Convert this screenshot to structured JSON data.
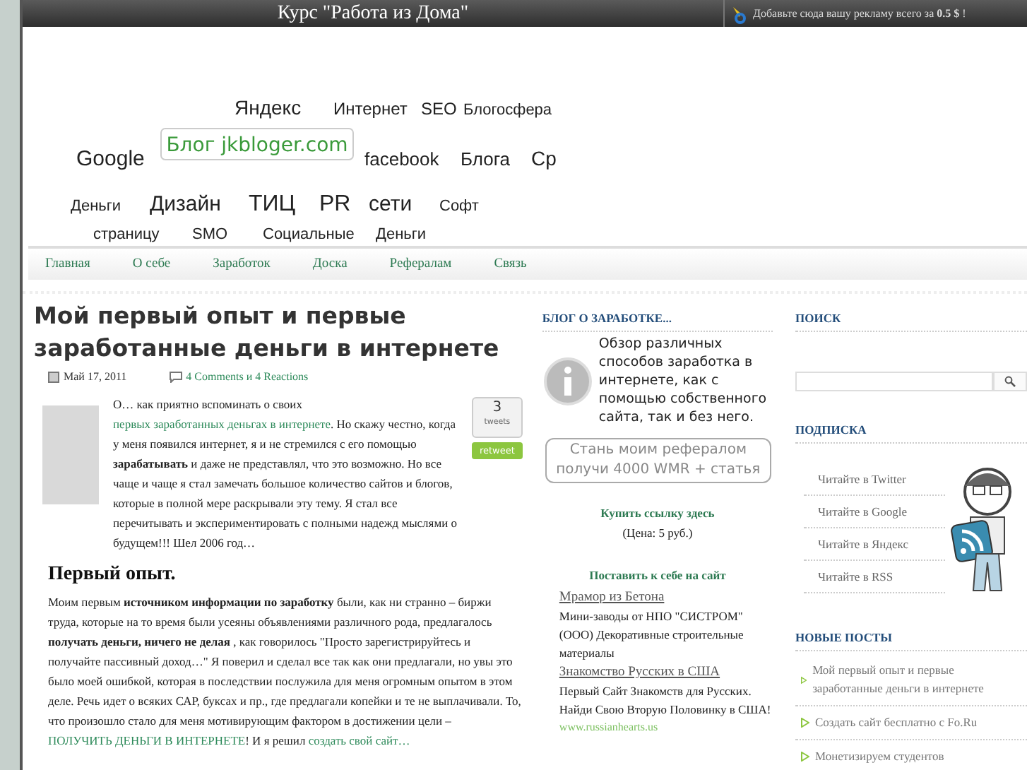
{
  "top_bar": {
    "title": "Курс \"Работа из Дома\"",
    "ad_text": "Добавьте сюда вашу рекламу всего за **0.5 $** !"
  },
  "header": {
    "logo_label": "Блог jkbloger.com",
    "cloud_words": [
      "Яндекс",
      "Интернет",
      "SEO",
      "Блогосфера",
      "Google",
      "facebook",
      "Блога",
      "Ср",
      "Деньги",
      "Дизайн",
      "ТИЦ",
      "PR",
      "сети",
      "Софт",
      "страницу",
      "SMO",
      "Социальные",
      "Деньги"
    ]
  },
  "nav": [
    "Главная",
    "О себе",
    "Заработок",
    "Доска",
    "Рефералам",
    "Связь"
  ],
  "post": {
    "title": "Мой первый опыт и первые заработанные деньги в интернете",
    "date": "Май 17, 2011",
    "comments": "4 Comments и 4 Reactions",
    "tweet_count": "3",
    "tweet_unit": "tweets",
    "retweet_label": "retweet",
    "intro": [
      {
        "kind": "text",
        "text": "О… как приятно вспоминать о своих "
      },
      {
        "kind": "link",
        "text": "первых заработанных деньгах в интернете"
      },
      {
        "kind": "text",
        "text": ". Но скажу честно, когда у меня появился интернет, я и не стремился  с его помощью **зарабатывать** и даже не представлял, что это возможно. Но все чаще и чаще я стал замечать большое количество сайтов и блогов, которые в полной мере раскрывали эту тему. Я стал все перечитывать и экспериментировать с полными надежд мыслями о будущем!!! Шел 2006 год…"
      }
    ],
    "heading": "Первый опыт.",
    "body": [
      {
        "kind": "text",
        "text": "Моим первым **источником информации по заработку**  были, как ни странно – биржи труда, которые на то время были усеяны объявлениями различного рода, предлагалось **получать деньги, ничего не делая** , как говорилось \"Просто зарегистрируйтесь и получайте пассивный доход…\" Я поверил и сделал все так как они предлагали, но увы это было моей ошибкой, которая в последствии послужила для меня огромным опытом в этом деле. Речь идет о всяких САР, буксах и пр., где предлагали копейки и те не выплачивали.  То, что произошло стало для меня мотивирующим фактором в достижении цели – "
      },
      {
        "kind": "link",
        "text": "ПОЛУЧИТЬ ДЕНЬГИ В ИНТЕРНЕТЕ"
      },
      {
        "kind": "text",
        "text": "! И я решил "
      },
      {
        "kind": "link",
        "text": "создать свой сайт…"
      }
    ]
  },
  "middle": {
    "title": "БЛОГ О ЗАРАБОТКЕ...",
    "info_text": "Обзор различных способов заработка в интернете, как с помощью собственного сайта, так и без него.",
    "referral_button": "Стань моим рефералом получи 4000 WMR + статья",
    "buy_link": "Купить ссылку здесь",
    "price": "(Цена: 5 руб.)",
    "install_link": "Поставить к себе на сайт",
    "ads": [
      {
        "title": "Мрамор из Бетона",
        "text": "Мини-заводы от НПО \"СИСТРОМ\" (ООО) Декоративные строительные материалы"
      },
      {
        "title": "Знакомство Русских в США",
        "text": "Первый Сайт Знакомств для Русских. Найди Свою Вторую Половинку в США!",
        "url": "www.russianhearts.us"
      }
    ]
  },
  "right": {
    "search_title": "ПОИСК",
    "subscribe_title": "ПОДПИСКА",
    "subscribe_links": [
      "Читайте в Twitter",
      "Читайте в Google",
      "Читайте в Яндекс",
      "Читайте в RSS"
    ],
    "posts_title": "НОВЫЕ ПОСТЫ",
    "posts": [
      "Мой первый опыт и первые заработанные деньги в интернете",
      "Создать сайт бесплатно с Fo.Ru",
      "Монетизируем студентов"
    ]
  }
}
